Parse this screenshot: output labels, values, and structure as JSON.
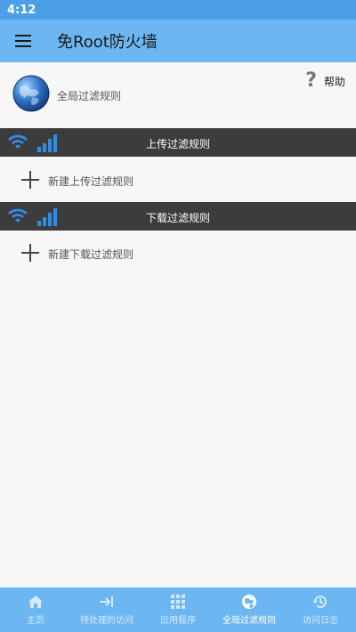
{
  "status_bar": {
    "time": "4:12"
  },
  "app_bar": {
    "title": "免Root防火墙"
  },
  "global": {
    "label": "全局过滤规则",
    "help_label": "帮助"
  },
  "upload": {
    "title": "上传过滤规则",
    "add_label": "新建上传过滤规则"
  },
  "download": {
    "title": "下载过滤规则",
    "add_label": "新建下载过滤规则"
  },
  "nav": {
    "items": [
      {
        "label": "主页",
        "icon": "home-icon"
      },
      {
        "label": "待处理的访问",
        "icon": "arrow-to-bar-icon"
      },
      {
        "label": "应用程序",
        "icon": "grid-icon"
      },
      {
        "label": "全局过滤规则",
        "icon": "globe-icon",
        "active": true
      },
      {
        "label": "访问日志",
        "icon": "history-icon"
      }
    ]
  },
  "colors": {
    "app_bar": "#6cb7f1",
    "status_bar": "#4a9fe6",
    "section_header": "#3c3c3c",
    "signal_blue": "#2f8de4"
  }
}
